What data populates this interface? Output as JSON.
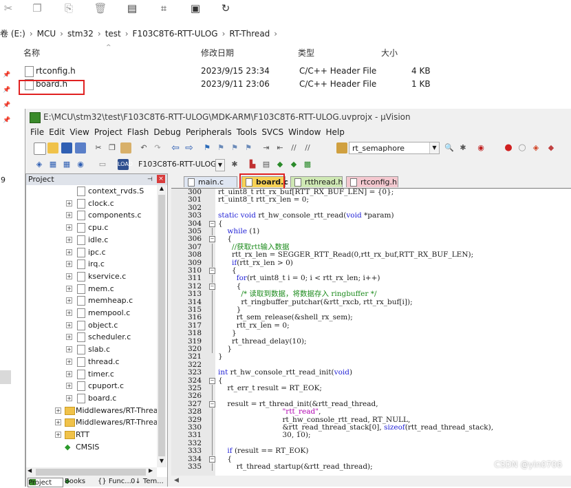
{
  "explorer": {
    "address": [
      "卷 (E:)",
      "MCU",
      "stm32",
      "test",
      "F103C8T6-RTT-ULOG",
      "RT-Thread"
    ],
    "columns": [
      "名称",
      "修改日期",
      "类型",
      "大小"
    ],
    "files": [
      {
        "name": "rtconfig.h",
        "date": "2023/9/15 23:34",
        "type": "C/C++ Header File",
        "size": "4 KB"
      },
      {
        "name": "board.h",
        "date": "2023/9/11 23:06",
        "type": "C/C++ Header File",
        "size": "1 KB"
      }
    ],
    "side_number": "9"
  },
  "uvision": {
    "title": "E:\\MCU\\stm32\\test\\F103C8T6-RTT-ULOG\\MDK-ARM\\F103C8T6-RTT-ULOG.uvprojx - µVision",
    "menu": [
      "File",
      "Edit",
      "View",
      "Project",
      "Flash",
      "Debug",
      "Peripherals",
      "Tools",
      "SVCS",
      "Window",
      "Help"
    ],
    "find_combo": "rt_semaphore",
    "target_combo": "F103C8T6-RTT-ULOG",
    "project_panel_title": "Project",
    "tree": [
      {
        "label": "context_rvds.S",
        "kind": "file",
        "expander": false
      },
      {
        "label": "clock.c",
        "kind": "file",
        "expander": true
      },
      {
        "label": "components.c",
        "kind": "file",
        "expander": true
      },
      {
        "label": "cpu.c",
        "kind": "file",
        "expander": true
      },
      {
        "label": "idle.c",
        "kind": "file",
        "expander": true
      },
      {
        "label": "ipc.c",
        "kind": "file",
        "expander": true
      },
      {
        "label": "irq.c",
        "kind": "file",
        "expander": true
      },
      {
        "label": "kservice.c",
        "kind": "file",
        "expander": true
      },
      {
        "label": "mem.c",
        "kind": "file",
        "expander": true
      },
      {
        "label": "memheap.c",
        "kind": "file",
        "expander": true
      },
      {
        "label": "mempool.c",
        "kind": "file",
        "expander": true
      },
      {
        "label": "object.c",
        "kind": "file",
        "expander": true
      },
      {
        "label": "scheduler.c",
        "kind": "file",
        "expander": true
      },
      {
        "label": "slab.c",
        "kind": "file",
        "expander": true
      },
      {
        "label": "thread.c",
        "kind": "file",
        "expander": true
      },
      {
        "label": "timer.c",
        "kind": "file",
        "expander": true
      },
      {
        "label": "cpuport.c",
        "kind": "file",
        "expander": true
      },
      {
        "label": "board.c",
        "kind": "file",
        "expander": true
      },
      {
        "label": "Middlewares/RT-Thread/R",
        "kind": "folder",
        "expander": true
      },
      {
        "label": "Middlewares/RT-Thread/R",
        "kind": "folder",
        "expander": true
      },
      {
        "label": "RTT",
        "kind": "folder",
        "expander": true
      },
      {
        "label": "CMSIS",
        "kind": "cmsis",
        "expander": false
      }
    ],
    "panel_tabs": [
      "Project",
      "Books",
      "{} Func...",
      "0↓ Tem..."
    ],
    "tabs": [
      {
        "label": "main.c",
        "bg": "#dfe6f2"
      },
      {
        "label": "board.c",
        "bg": "#f7d154"
      },
      {
        "label": "rtthread.h",
        "bg": "#cfe8b4"
      },
      {
        "label": "rtconfig.h",
        "bg": "#f4c8cf"
      }
    ],
    "code": [
      {
        "n": "300",
        "t": "rt_uint8_t rtt_rx_buf[RTT_RX_BUF_LEN] = {0};"
      },
      {
        "n": "301",
        "t": "rt_uint8_t rtt_rx_len = 0;"
      },
      {
        "n": "302",
        "t": ""
      },
      {
        "n": "303",
        "t": "static void rt_hw_console_rtt_read(void *param)"
      },
      {
        "n": "304",
        "t": "{"
      },
      {
        "n": "305",
        "t": "    while (1)"
      },
      {
        "n": "306",
        "t": "    {"
      },
      {
        "n": "307",
        "t": "      //获取rtt输入数据"
      },
      {
        "n": "308",
        "t": "      rtt_rx_len = SEGGER_RTT_Read(0,rtt_rx_buf,RTT_RX_BUF_LEN);"
      },
      {
        "n": "309",
        "t": "      if(rtt_rx_len > 0)"
      },
      {
        "n": "310",
        "t": "      {"
      },
      {
        "n": "311",
        "t": "        for(rt_uint8_t i = 0; i < rtt_rx_len; i++)"
      },
      {
        "n": "312",
        "t": "        {"
      },
      {
        "n": "313",
        "t": "          /* 读取到数据，将数据存入 ringbuffer */"
      },
      {
        "n": "314",
        "t": "          rt_ringbuffer_putchar(&rtt_rxcb, rtt_rx_buf[i]);"
      },
      {
        "n": "315",
        "t": "        }"
      },
      {
        "n": "316",
        "t": "        rt_sem_release(&shell_rx_sem);"
      },
      {
        "n": "317",
        "t": "        rtt_rx_len = 0;"
      },
      {
        "n": "318",
        "t": "      }"
      },
      {
        "n": "319",
        "t": "      rt_thread_delay(10);"
      },
      {
        "n": "320",
        "t": "    }"
      },
      {
        "n": "321",
        "t": "}"
      },
      {
        "n": "322",
        "t": ""
      },
      {
        "n": "323",
        "t": "int rt_hw_console_rtt_read_init(void)"
      },
      {
        "n": "324",
        "t": "{"
      },
      {
        "n": "325",
        "t": "    rt_err_t result = RT_EOK;"
      },
      {
        "n": "326",
        "t": ""
      },
      {
        "n": "327",
        "t": "    result = rt_thread_init(&rtt_read_thread,"
      },
      {
        "n": "328",
        "t": "                            \"rtt_read\","
      },
      {
        "n": "329",
        "t": "                            rt_hw_console_rtt_read, RT_NULL,"
      },
      {
        "n": "330",
        "t": "                            &rtt_read_thread_stack[0], sizeof(rtt_read_thread_stack),"
      },
      {
        "n": "331",
        "t": "                            30, 10);"
      },
      {
        "n": "332",
        "t": ""
      },
      {
        "n": "333",
        "t": "    if (result == RT_EOK)"
      },
      {
        "n": "334",
        "t": "    {"
      },
      {
        "n": "335",
        "t": "        rt_thread_startup(&rtt_read_thread);"
      }
    ]
  },
  "watermark": "CSDN @yin0706",
  "colors": {
    "keyword": "#1f1fd6",
    "comment": "#1a8a1a",
    "string": "#b000b0",
    "highlight_red": "#e02020"
  }
}
